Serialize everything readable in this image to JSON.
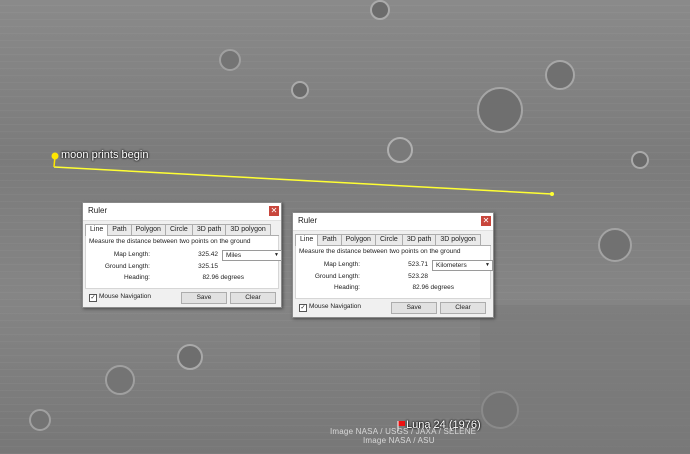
{
  "map": {
    "placemark_label": "moon prints begin",
    "mission_label": "Luna 24 (1976)",
    "credit_1": "Image NASA / USGS / JAXA / SELENE",
    "credit_2": "Image NASA / ASU",
    "measure_line_color": "#ffff33",
    "pin_color": "#ffe600"
  },
  "rulers": [
    {
      "title": "Ruler",
      "close_icon": "close-icon",
      "tabs": [
        "Line",
        "Path",
        "Polygon",
        "Circle",
        "3D path",
        "3D polygon"
      ],
      "active_tab": "Line",
      "description": "Measure the distance between two points on the ground",
      "map_length_label": "Map Length:",
      "map_length_value": "325.42",
      "unit": "Miles",
      "ground_length_label": "Ground Length:",
      "ground_length_value": "325.15",
      "heading_label": "Heading:",
      "heading_value": "82.96 degrees",
      "mouse_nav_label": "Mouse Navigation",
      "mouse_nav_checked": true,
      "save_label": "Save",
      "clear_label": "Clear"
    },
    {
      "title": "Ruler",
      "close_icon": "close-icon",
      "tabs": [
        "Line",
        "Path",
        "Polygon",
        "Circle",
        "3D path",
        "3D polygon"
      ],
      "active_tab": "Line",
      "description": "Measure the distance between two points on the ground",
      "map_length_label": "Map Length:",
      "map_length_value": "523.71",
      "unit": "Kilometers",
      "ground_length_label": "Ground Length:",
      "ground_length_value": "523.28",
      "heading_label": "Heading:",
      "heading_value": "82.96 degrees",
      "mouse_nav_label": "Mouse Navigation",
      "mouse_nav_checked": true,
      "save_label": "Save",
      "clear_label": "Clear"
    }
  ]
}
